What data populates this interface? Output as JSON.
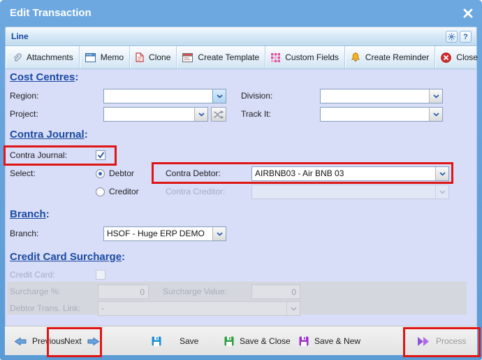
{
  "window": {
    "title": "Edit Transaction"
  },
  "panel": {
    "title": "Line",
    "help_glyph": "?"
  },
  "punct": {
    "colon": ":"
  },
  "toolbar": {
    "items": [
      {
        "label": "Attachments",
        "icon": "attachments-paperclip-icon"
      },
      {
        "label": "Memo",
        "icon": "memo-icon"
      },
      {
        "label": "Clone",
        "icon": "clone-icon"
      },
      {
        "label": "Create Template",
        "icon": "create-template-icon"
      },
      {
        "label": "Custom Fields",
        "icon": "custom-fields-icon"
      },
      {
        "label": "Create Reminder",
        "icon": "reminder-bell-icon"
      },
      {
        "label": "Close",
        "icon": "close-red-circle-icon"
      }
    ]
  },
  "cost_centres": {
    "heading": "Cost Centres",
    "region_label": "Region:",
    "region_value": "",
    "division_label": "Division:",
    "division_value": "",
    "project_label": "Project:",
    "project_value": "",
    "track_it_label": "Track It:",
    "track_it_value": ""
  },
  "contra_journal": {
    "heading": "Contra Journal",
    "contra_journal_label": "Contra Journal:",
    "contra_journal_checked": true,
    "select_label": "Select:",
    "debtor_option_label": "Debtor",
    "creditor_option_label": "Creditor",
    "selected_option": "Debtor",
    "contra_debtor_label": "Contra Debtor:",
    "contra_debtor_value": "AIRBNB03 - Air BNB 03",
    "contra_creditor_label": "Contra Creditor:",
    "contra_creditor_value": ""
  },
  "branch": {
    "heading": "Branch",
    "branch_label": "Branch:",
    "branch_value": "HSOF - Huge ERP DEMO"
  },
  "credit_card_surcharge": {
    "heading": "Credit Card Surcharge",
    "credit_card_label": "Credit Card:",
    "credit_card_checked": false,
    "surcharge_pct_label": "Surcharge %:",
    "surcharge_pct_value": "0",
    "surcharge_value_label": "Surcharge Value:",
    "surcharge_value_value": "0",
    "debtor_trans_link_label": "Debtor Trans. Link:",
    "debtor_trans_link_value": "-"
  },
  "footer": {
    "items": [
      {
        "label": "Previous",
        "icon": "previous-arrow-icon",
        "enabled": true
      },
      {
        "label": "Next",
        "icon": "next-arrow-icon",
        "enabled": true
      },
      {
        "label": "Save",
        "icon": "save-floppy-blue-icon",
        "enabled": true
      },
      {
        "label": "Save & Close",
        "icon": "save-close-floppy-green-icon",
        "enabled": true
      },
      {
        "label": "Save & New",
        "icon": "save-new-floppy-purple-icon",
        "enabled": true
      },
      {
        "label": "Process",
        "icon": "process-double-chevron-icon",
        "enabled": false
      }
    ]
  },
  "colors": {
    "titlebar": "#5b9bd5",
    "content_bg": "#d8ddf8",
    "heading": "#1b4aa2",
    "annotation_red": "#e01515",
    "disabled_band": "#d4d7de"
  }
}
